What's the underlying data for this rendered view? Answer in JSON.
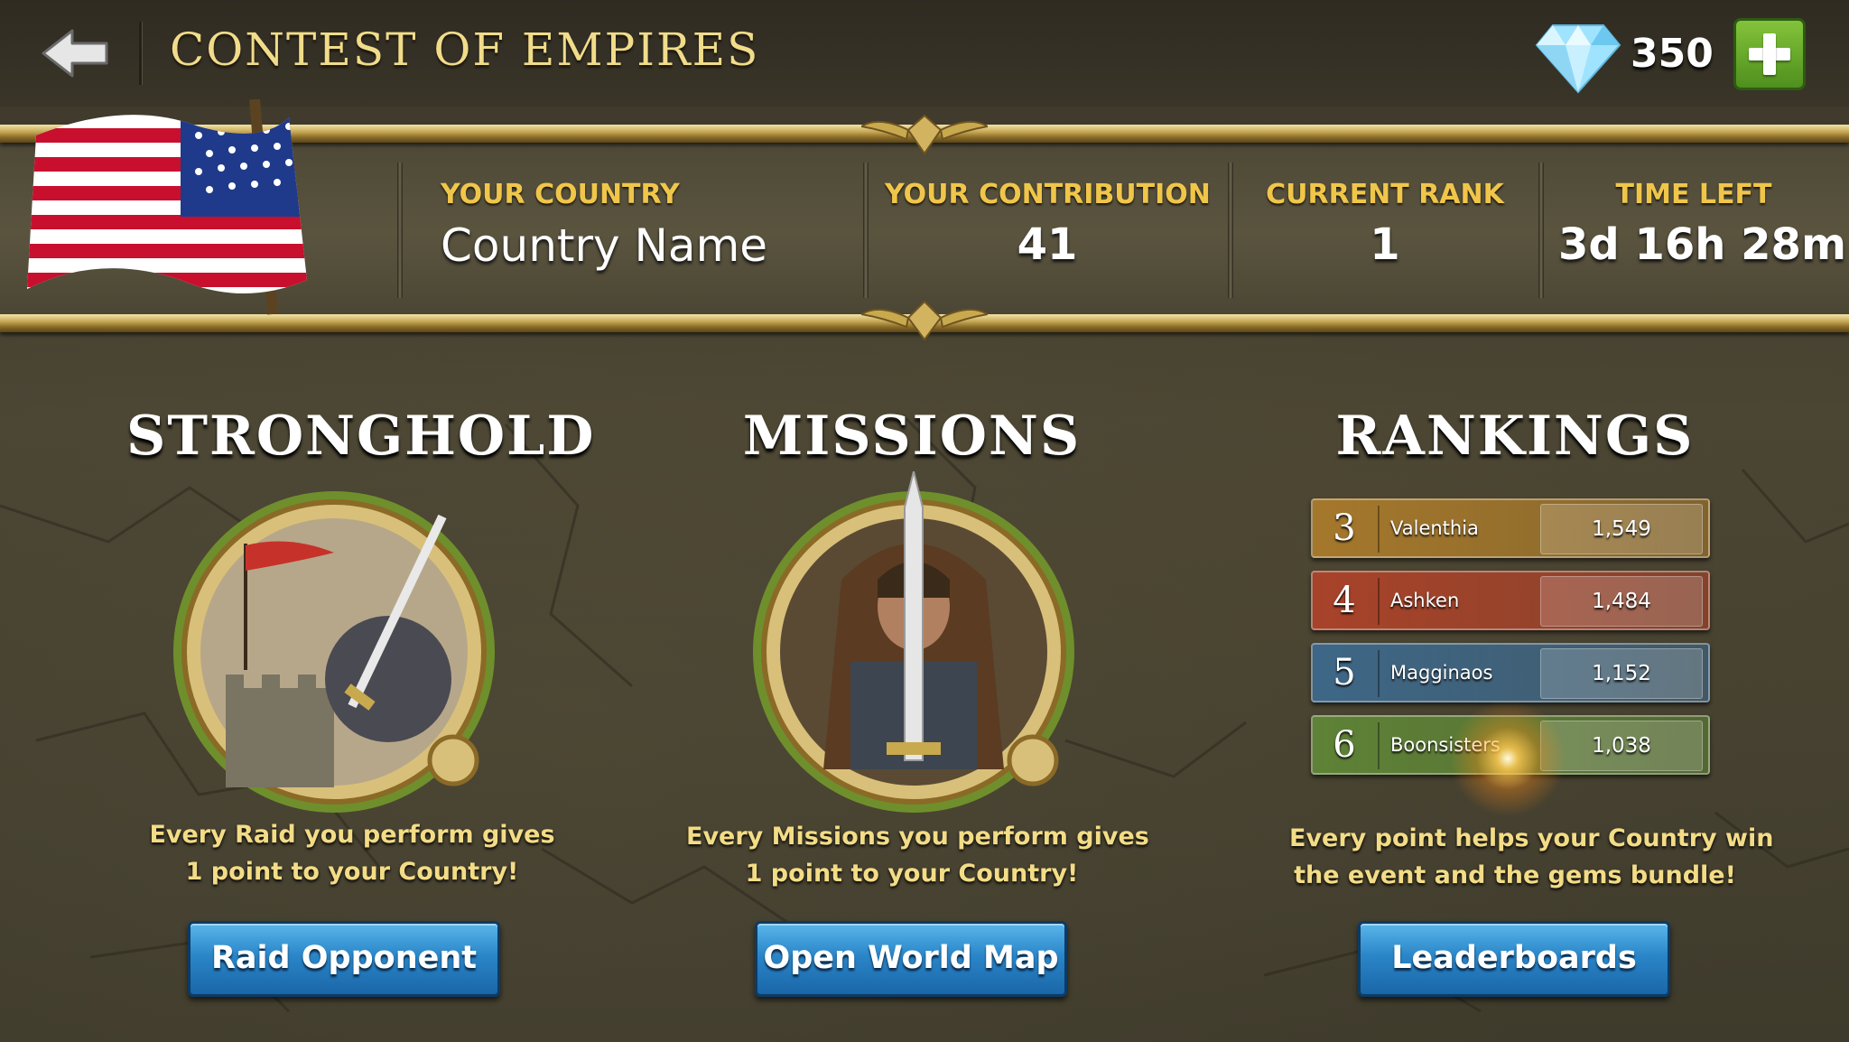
{
  "header": {
    "title": "CONTEST OF EMPIRES",
    "gems": "350"
  },
  "info": {
    "country_label": "YOUR COUNTRY",
    "country_value": "Country Name",
    "contribution_label": "YOUR CONTRIBUTION",
    "contribution_value": "41",
    "rank_label": "CURRENT RANK",
    "rank_value": "1",
    "time_label": "TIME LEFT",
    "time_value": "3d 16h 28m"
  },
  "stronghold": {
    "title": "STRONGHOLD",
    "desc_line1": "Every Raid you perform gives",
    "desc_line2": "1 point to your Country!",
    "button": "Raid Opponent"
  },
  "missions": {
    "title": "MISSIONS",
    "desc_line1": "Every Missions you perform gives",
    "desc_line2": "1 point to your Country!",
    "button": "Open World Map"
  },
  "rankings": {
    "title": "RANKINGS",
    "rows": [
      {
        "rank": "3",
        "name": "Valenthia",
        "score": "1,549",
        "color": "#a5782c"
      },
      {
        "rank": "4",
        "name": "Ashken",
        "score": "1,484",
        "color": "#a8432a"
      },
      {
        "rank": "5",
        "name": "Magginaos",
        "score": "1,152",
        "color": "#3e6787"
      },
      {
        "rank": "6",
        "name": "Boonsisters",
        "score": "1,038",
        "color": "#5e8237"
      }
    ],
    "desc_line1": "Every point helps your Country win",
    "desc_line2": "the event and the gems bundle!",
    "button": "Leaderboards"
  },
  "colors": {
    "title_gold": "#f1dc8a",
    "label_gold": "#f0c64a",
    "button_blue": "#2a86c8",
    "plus_green": "#6aa82c"
  },
  "icons": [
    "back-arrow-icon",
    "gem-icon",
    "plus-icon",
    "us-flag-icon"
  ]
}
